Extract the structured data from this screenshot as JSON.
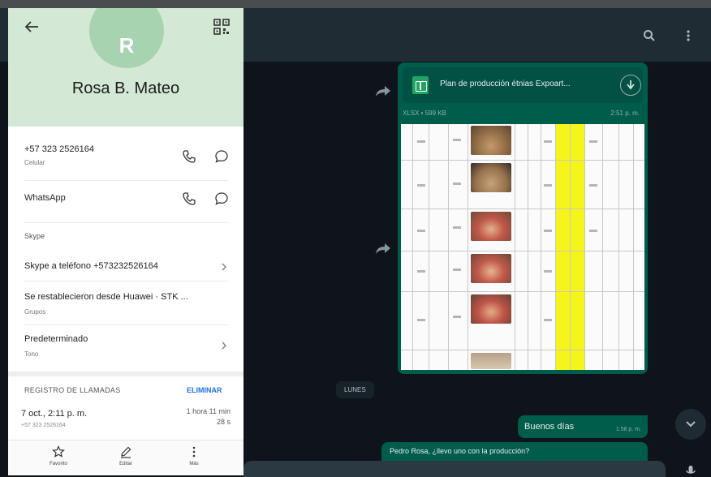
{
  "contact": {
    "avatar_letter": "R",
    "name": "Rosa B. Mateo",
    "phone": "+57 323 2526164",
    "phone_type": "Celular",
    "whatsapp_label": "WhatsApp",
    "skype_section": "Skype",
    "skype_call_label": "Skype a teléfono +573232526164",
    "restored_label": "Se restablecieron desde Huawei · STK ...",
    "restored_sub": "Grupos",
    "ringtone_label": "Predeterminado",
    "ringtone_sub": "Tono",
    "call_log": {
      "title": "REGISTRO DE LLAMADAS",
      "delete_label": "ELIMINAR",
      "date": "7 oct., 2:11 p. m.",
      "number": "+57 323 2526164",
      "duration": "1 hora 11 min",
      "seconds": "28 s"
    },
    "bottom_bar": {
      "favorite": "Favorito",
      "edit": "Editar",
      "more": "Más"
    }
  },
  "chat": {
    "document": {
      "name": "Plan de producción étnias Expoart...",
      "meta": "XLSX • 599 KB",
      "time": "2:51 p. m."
    },
    "date_chip": "LUNES",
    "message_1": {
      "text": "Buenos días",
      "time": "1:58 p. m."
    },
    "message_2": {
      "text": "Pedro Rosa, ¿llevo uno con la producción?"
    }
  },
  "icons": {
    "back": "back-arrow-icon",
    "qr": "qr-code-icon",
    "phone": "phone-icon",
    "message": "message-icon",
    "chevron": "chevron-right-icon",
    "star": "star-icon",
    "edit": "pencil-icon",
    "more": "more-vertical-icon",
    "search": "search-icon",
    "menu": "menu-dots-icon",
    "download": "download-icon",
    "forward": "forward-icon",
    "scroll_down": "chevron-down-icon",
    "mic": "mic-icon"
  },
  "colors": {
    "header_green": "#d4e8d6",
    "avatar_green": "#a8d3b0",
    "outgoing_bubble": "#005c4b",
    "chat_background": "#0e1419",
    "link_blue": "#1a73e8",
    "highlight_yellow": "#f5f51a"
  }
}
